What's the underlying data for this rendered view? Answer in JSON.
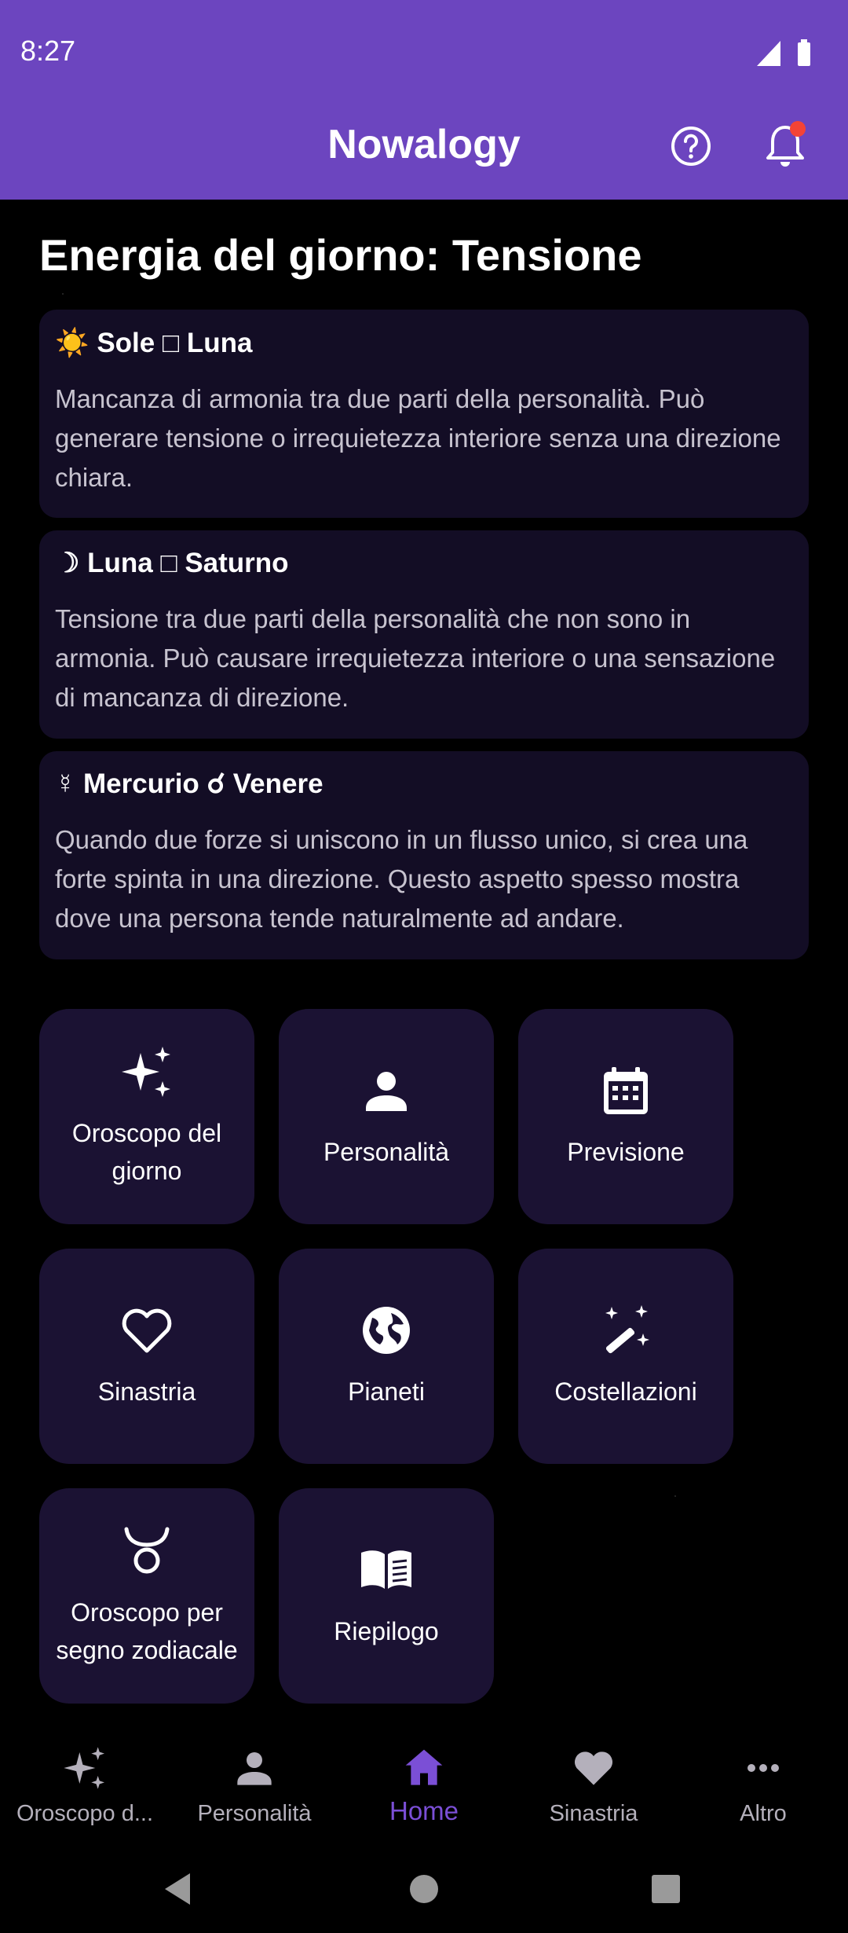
{
  "status_bar": {
    "time": "8:27"
  },
  "app_bar": {
    "title": "Nowalogy"
  },
  "energy": {
    "title": "Energia del giorno: Tensione",
    "aspects": [
      {
        "symbol": "☀️",
        "title": "Sole □ Luna",
        "description": "Mancanza di armonia tra due parti della personalità. Può generare tensione o irrequietezza interiore senza una direzione chiara."
      },
      {
        "symbol": "☽",
        "title": "Luna □ Saturno",
        "description": "Tensione tra due parti della personalità che non sono in armonia. Può causare irrequietezza interiore o una sensazione di mancanza di direzione."
      },
      {
        "symbol": "☿",
        "title": "Mercurio ☌ Venere",
        "description": "Quando due forze si uniscono in un flusso unico, si crea una forte spinta in una direzione. Questo aspetto spesso mostra dove una persona tende naturalmente ad andare."
      }
    ]
  },
  "tiles": [
    {
      "icon": "sparkles-icon",
      "label": "Oroscopo del giorno"
    },
    {
      "icon": "person-icon",
      "label": "Personalità"
    },
    {
      "icon": "calendar-icon",
      "label": "Previsione"
    },
    {
      "icon": "heart-outline-icon",
      "label": "Sinastria"
    },
    {
      "icon": "globe-icon",
      "label": "Pianeti"
    },
    {
      "icon": "magic-wand-icon",
      "label": "Costellazioni"
    },
    {
      "icon": "taurus-icon",
      "label": "Oroscopo per segno zodiacale"
    },
    {
      "icon": "book-icon",
      "label": "Riepilogo"
    }
  ],
  "bottom_nav": [
    {
      "icon": "sparkles-icon",
      "label": "Oroscopo d...",
      "active": false
    },
    {
      "icon": "person-icon",
      "label": "Personalità",
      "active": false
    },
    {
      "icon": "home-icon",
      "label": "Home",
      "active": true
    },
    {
      "icon": "heart-icon",
      "label": "Sinastria",
      "active": false
    },
    {
      "icon": "more-icon",
      "label": "Altro",
      "active": false
    }
  ],
  "colors": {
    "accent": "#6c45bf",
    "active_nav": "#7b4fd6",
    "card_bg": "#130d25",
    "tile_bg": "#1b1233"
  }
}
